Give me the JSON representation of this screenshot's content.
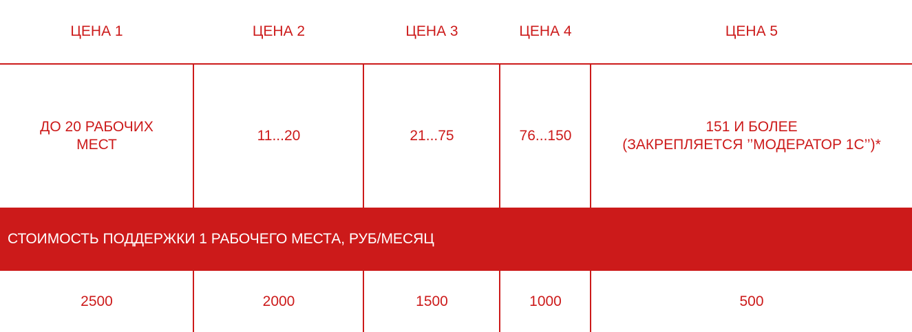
{
  "colors": {
    "accent": "#cc1a1a",
    "band_text": "#ffffff",
    "background": "#ffffff"
  },
  "headers": [
    "ЦЕНА 1",
    "ЦЕНА 2",
    "ЦЕНА 3",
    "ЦЕНА 4",
    "ЦЕНА 5"
  ],
  "ranges": [
    "ДО 20 РАБОЧИХ\nМЕСТ",
    "11...20",
    "21...75",
    "76...150",
    "151 И БОЛЕЕ\n(ЗАКРЕПЛЯЕТСЯ ’’МОДЕРАТОР 1С’’)*"
  ],
  "band_label": "СТОИМОСТЬ ПОДДЕРЖКИ 1 РАБОЧЕГО МЕСТА, РУБ/МЕСЯЦ",
  "prices": [
    "2500",
    "2000",
    "1500",
    "1000",
    "500"
  ]
}
